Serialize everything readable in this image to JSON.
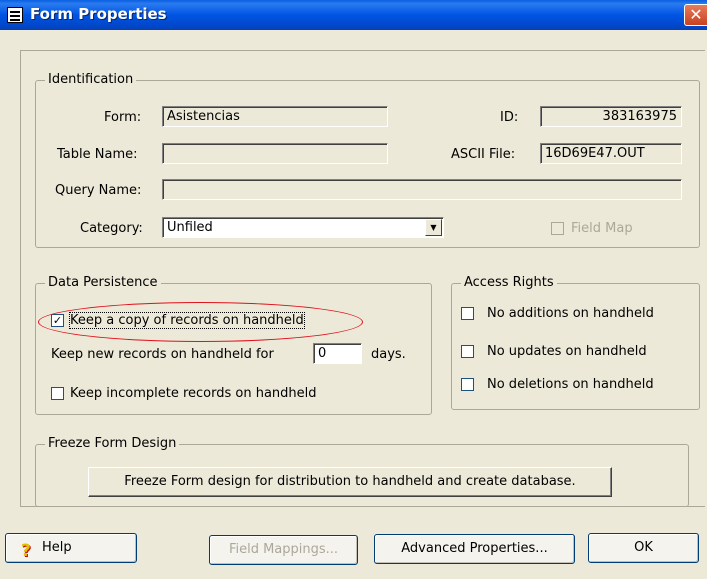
{
  "window": {
    "title": "Form Properties",
    "close_glyph": "✕"
  },
  "identification": {
    "legend": "Identification",
    "form_label": "Form:",
    "form_value": "Asistencias",
    "id_label": "ID:",
    "id_value": "383163975",
    "table_name_label": "Table Name:",
    "table_name_value": "",
    "ascii_file_label": "ASCII File:",
    "ascii_file_value": "16D69E47.OUT",
    "query_name_label": "Query Name:",
    "query_name_value": "",
    "category_label": "Category:",
    "category_value": "Unfiled",
    "field_map_label": "Field Map",
    "field_map_checked": false
  },
  "data_persistence": {
    "legend": "Data Persistence",
    "keep_copy_label": "Keep a copy of records on handheld",
    "keep_copy_checked": true,
    "keep_new_label": "Keep new records on handheld for",
    "keep_new_value": "0",
    "days_label": "days.",
    "keep_incomplete_label": "Keep incomplete records on handheld",
    "keep_incomplete_checked": false
  },
  "access_rights": {
    "legend": "Access Rights",
    "no_additions_label": "No additions on handheld",
    "no_updates_label": "No updates on handheld",
    "no_deletions_label": "No deletions on handheld"
  },
  "freeze": {
    "legend": "Freeze Form Design",
    "button_label": "Freeze Form design for distribution to handheld and create database."
  },
  "footer": {
    "help_label": "Help",
    "help_glyph": "?",
    "field_mappings_label": "Field Mappings...",
    "advanced_label": "Advanced Properties...",
    "ok_label": "OK"
  },
  "colors": {
    "titlebar": "#0054e3",
    "annotation": "#e0101a",
    "face": "#ece9d8"
  }
}
